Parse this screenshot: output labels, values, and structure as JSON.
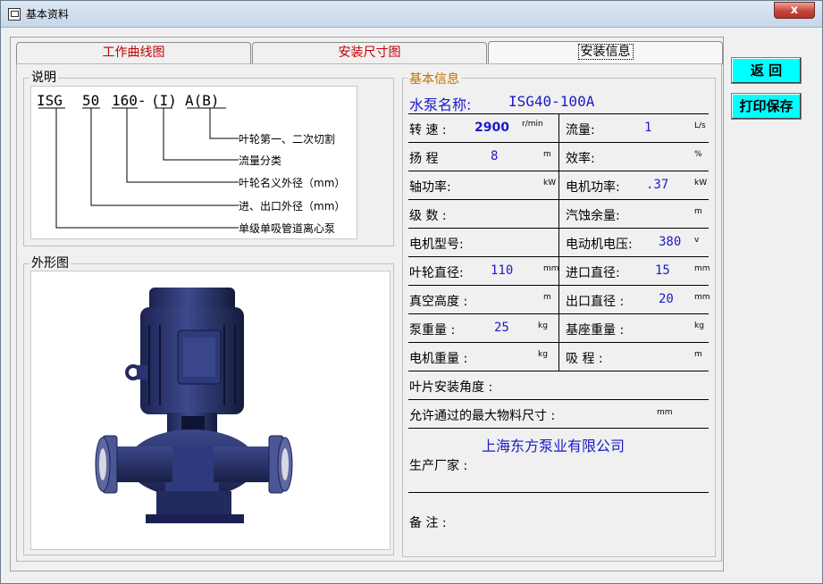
{
  "window": {
    "title": "基本资料",
    "ghost_menu": [
      "",
      "",
      "",
      "",
      ""
    ],
    "close_glyph": "x"
  },
  "tabs": [
    {
      "label": "工作曲线图",
      "active": false
    },
    {
      "label": "安装尺寸图",
      "active": false
    },
    {
      "label": "安装信息",
      "active": true
    }
  ],
  "description": {
    "group_label": "说明",
    "model_parts": [
      "ISG",
      "50",
      "160-",
      "(I)",
      "A(B)"
    ],
    "notes": [
      "叶轮第一、二次切割",
      "流量分类",
      "叶轮名义外径（mm）",
      "进、出口外径（mm）",
      "单级单吸管道离心泵"
    ]
  },
  "appearance": {
    "group_label": "外形图"
  },
  "info": {
    "group_label": "基本信息",
    "pump_name_label": "水泵名称:",
    "pump_name_value": "ISG40-100A",
    "speed": {
      "label": "转 速 :",
      "value": "2900",
      "unit": "r/min"
    },
    "flow": {
      "label": "流量:",
      "value": "1",
      "unit": "L/s"
    },
    "head": {
      "label": "扬 程",
      "value": "8",
      "unit": "m"
    },
    "efficiency": {
      "label": "效率:",
      "value": "",
      "unit": "%"
    },
    "shaft_power": {
      "label": "轴功率:",
      "value": "",
      "unit": "kW"
    },
    "motor_power": {
      "label": "电机功率:",
      "value": ".37",
      "unit": "kW"
    },
    "stages": {
      "label": "级 数 :",
      "value": ""
    },
    "npsh": {
      "label": "汽蚀余量:",
      "value": "",
      "unit": "m"
    },
    "motor_model": {
      "label": "电机型号:",
      "value": ""
    },
    "motor_voltage": {
      "label": "电动机电压:",
      "value": "380",
      "unit": "v"
    },
    "impeller_dia": {
      "label": "叶轮直径:",
      "value": "110",
      "unit": "mm"
    },
    "inlet_dia": {
      "label": "进口直径:",
      "value": "15",
      "unit": "mm"
    },
    "vacuum_height": {
      "label": "真空高度 :",
      "value": "",
      "unit": "m"
    },
    "outlet_dia": {
      "label": "出口直径 :",
      "value": "20",
      "unit": "mm"
    },
    "pump_weight": {
      "label": "泵重量 :",
      "value": "25",
      "unit": "kg"
    },
    "base_weight": {
      "label": "基座重量 :",
      "value": "",
      "unit": "kg"
    },
    "motor_weight": {
      "label": "电机重量 :",
      "value": "",
      "unit": "kg"
    },
    "suction": {
      "label": "吸 程 :",
      "value": "",
      "unit": "m"
    },
    "blade_angle": {
      "label": "叶片安装角度 :",
      "value": ""
    },
    "max_particle": {
      "label": "允许通过的最大物料尺寸 :",
      "value": "",
      "unit": "mm"
    },
    "manufacturer_value": "上海东方泵业有限公司",
    "manufacturer_label": "生产厂家 :",
    "remarks_label": "备 注 :"
  },
  "buttons": {
    "back": "返 回",
    "print_save": "打印保存"
  },
  "colors": {
    "button_bg": "#00ffff",
    "value_blue": "#1a1ac8",
    "tab_red": "#c00000",
    "pump_blue": "#2a3470"
  }
}
